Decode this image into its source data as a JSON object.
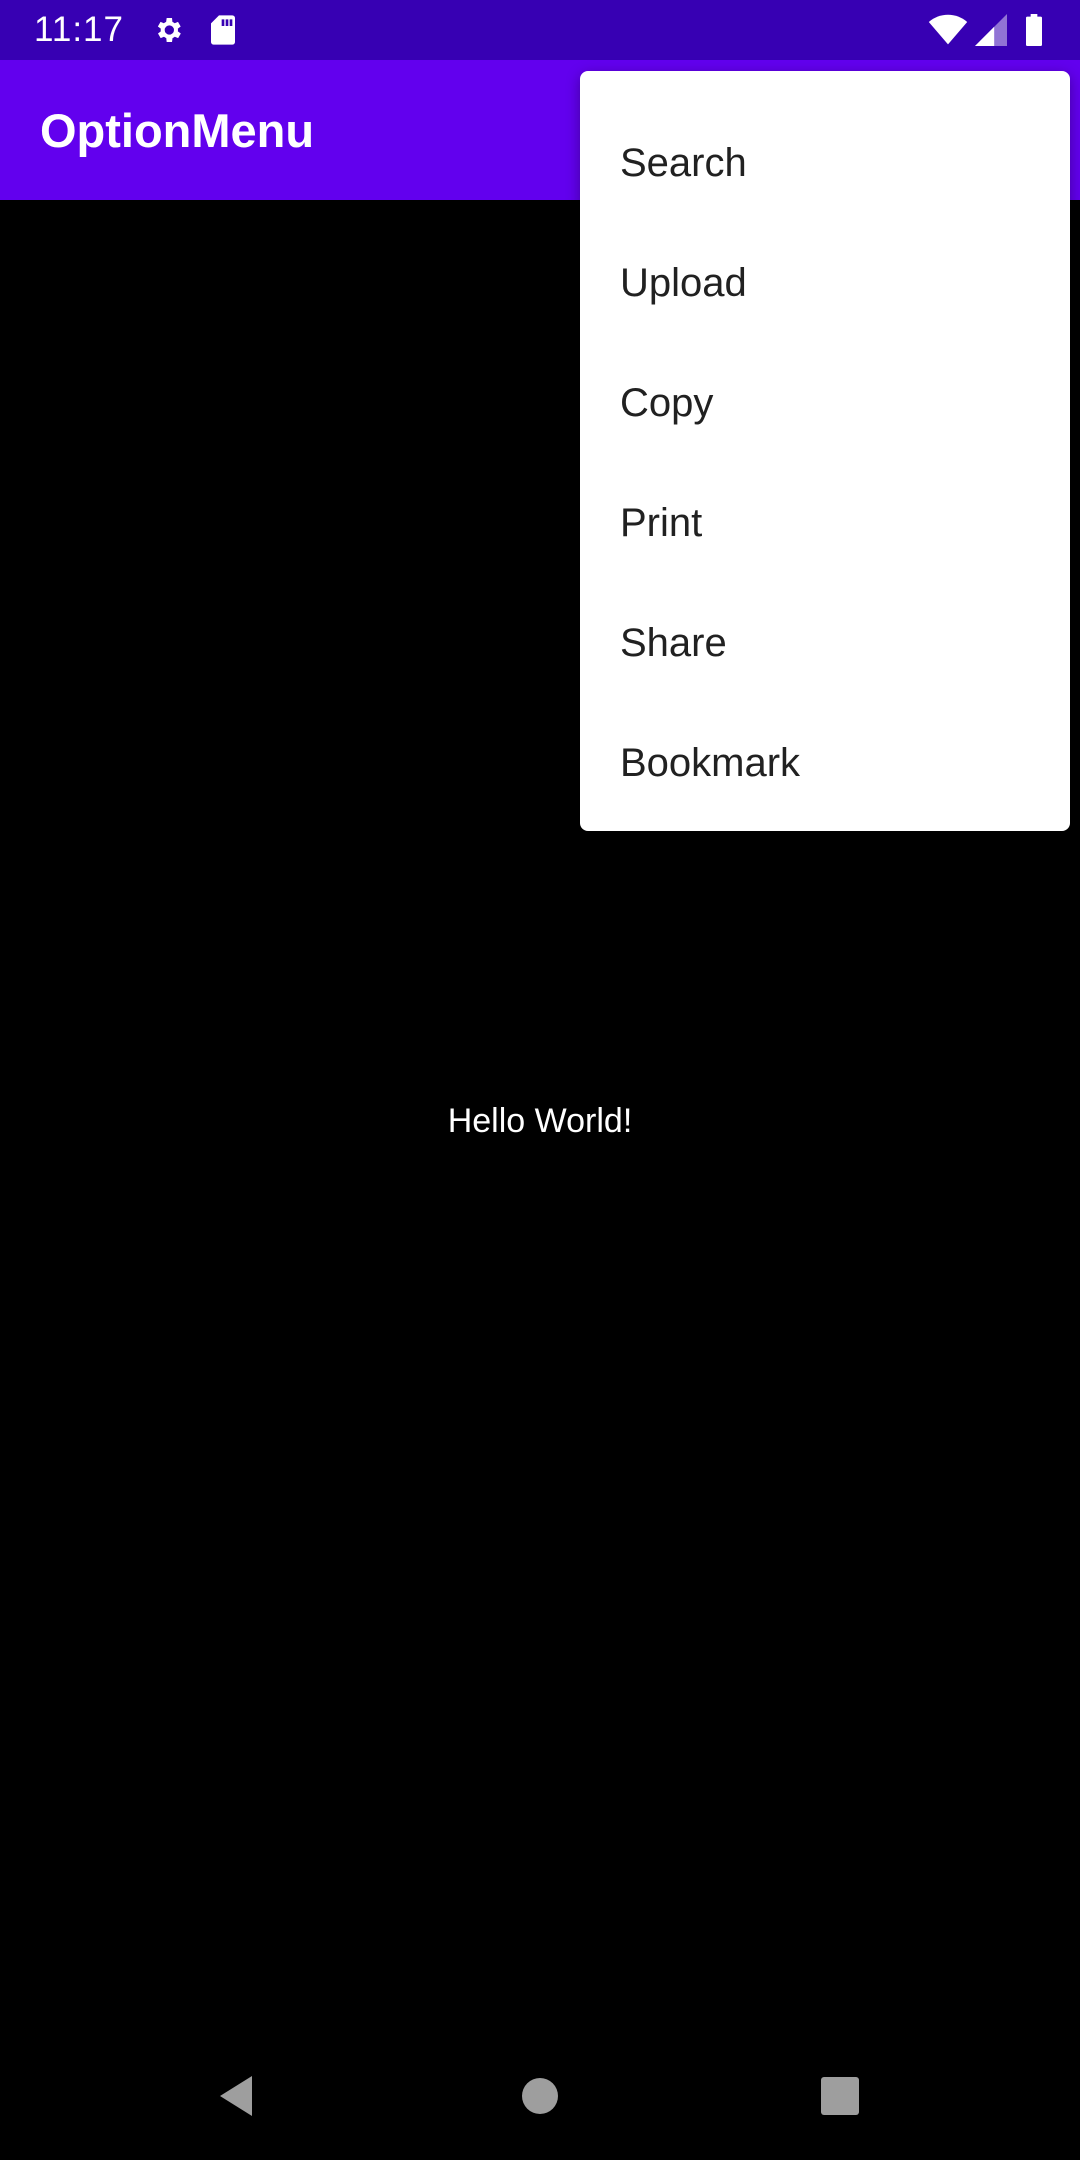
{
  "status_bar": {
    "time": "11:17",
    "icons": [
      "gear-icon",
      "sd-card-icon",
      "wifi-icon",
      "cellular-signal-icon",
      "battery-icon"
    ]
  },
  "app_bar": {
    "title": "OptionMenu"
  },
  "menu": {
    "items": [
      {
        "label": "Search"
      },
      {
        "label": "Upload"
      },
      {
        "label": "Copy"
      },
      {
        "label": "Print"
      },
      {
        "label": "Share"
      },
      {
        "label": "Bookmark"
      }
    ]
  },
  "content": {
    "text": "Hello World!"
  },
  "nav_bar": {
    "icons": [
      "back-icon",
      "home-icon",
      "recents-icon"
    ]
  },
  "colors": {
    "status_bar": "#3700B3",
    "app_bar": "#6200EE",
    "background": "#000000",
    "menu": "#FFFFFF"
  }
}
